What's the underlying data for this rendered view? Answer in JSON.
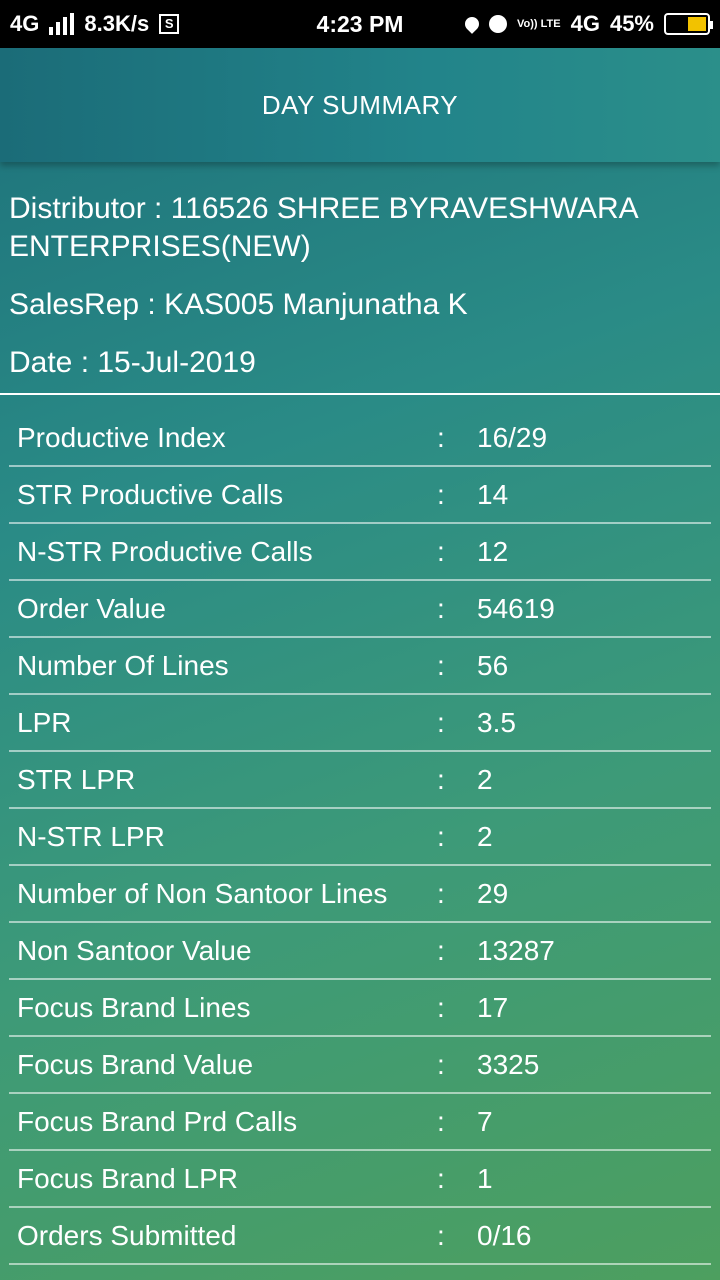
{
  "status_bar": {
    "network": "4G",
    "speed": "8.3K/s",
    "time": "4:23 PM",
    "volte": "Vo)) LTE",
    "network2": "4G",
    "battery": "45%"
  },
  "header": {
    "title": "DAY SUMMARY"
  },
  "info": {
    "distributor": "Distributor : 116526 SHREE BYRAVESHWARA ENTERPRISES(NEW)",
    "salesrep": "SalesRep : KAS005 Manjunatha K",
    "date": "Date : 15-Jul-2019"
  },
  "summary": [
    {
      "label": "Productive Index",
      "value": "16/29"
    },
    {
      "label": "STR Productive Calls",
      "value": "14"
    },
    {
      "label": "N-STR Productive Calls",
      "value": "12"
    },
    {
      "label": "Order Value",
      "value": "54619"
    },
    {
      "label": "Number Of Lines",
      "value": "56"
    },
    {
      "label": "LPR",
      "value": "3.5"
    },
    {
      "label": "STR LPR",
      "value": "2"
    },
    {
      "label": "N-STR LPR",
      "value": "2"
    },
    {
      "label": "Number of Non Santoor Lines",
      "value": "29"
    },
    {
      "label": "Non Santoor Value",
      "value": "13287"
    },
    {
      "label": "Focus Brand Lines",
      "value": "17"
    },
    {
      "label": "Focus Brand Value",
      "value": "3325"
    },
    {
      "label": "Focus Brand Prd Calls",
      "value": "7"
    },
    {
      "label": "Focus Brand LPR",
      "value": "1"
    },
    {
      "label": "Orders Submitted",
      "value": "0/16"
    }
  ],
  "separator": ":",
  "colors": {
    "battery_fill": "#f2c200",
    "header": "#1b6c78"
  }
}
